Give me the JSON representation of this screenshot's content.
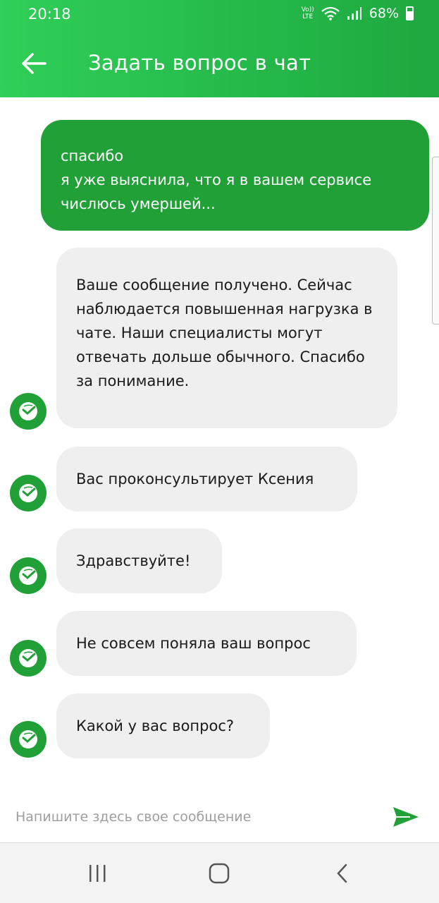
{
  "status_bar": {
    "time": "20:18",
    "network_line1": "Vo))",
    "network_line2": "LTE",
    "battery": "68%"
  },
  "header": {
    "title": "Задать вопрос в чат",
    "back_icon": "arrow-left-icon"
  },
  "colors": {
    "brand_green": "#21a038",
    "header_gradient_start": "#2fcf58",
    "header_gradient_end": "#1ea83f",
    "incoming_bubble": "#efefef"
  },
  "messages": {
    "outgoing": {
      "lines": [
        "спасибо",
        "я уже выяснила, что я в вашем сервисе",
        "числюсь умершей..."
      ]
    },
    "incoming": [
      {
        "text": "Ваше сообщение получено. Сейчас наблюдается повышенная нагрузка в чате. Наши специалисты могут отвечать дольше обычного. Спасибо за понимание."
      },
      {
        "text": "Вас проконсультирует Ксения"
      },
      {
        "text": "Здравствуйте!"
      },
      {
        "text": "Не совсем поняла ваш вопрос"
      },
      {
        "text": "Какой у вас вопрос?"
      }
    ]
  },
  "composer": {
    "placeholder": "Напишите здесь свое сообщение",
    "send_icon": "send-icon"
  },
  "system_nav": {
    "recents_icon": "recents-icon",
    "home_icon": "home-icon",
    "back_icon": "back-chevron-icon"
  }
}
